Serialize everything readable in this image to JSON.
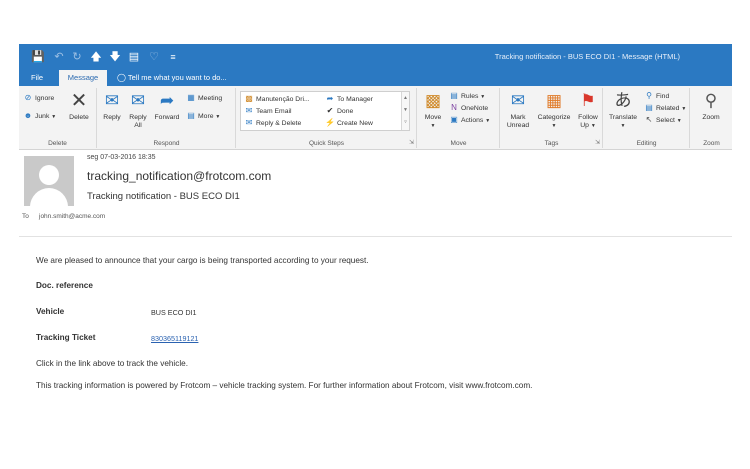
{
  "window": {
    "title": "Tracking notification - BUS ECO DI1 - Message (HTML)"
  },
  "quick_access": {
    "save_icon": "save-icon",
    "undo_icon": "undo-icon",
    "redo_icon": "redo-icon",
    "up_icon": "up-arrow-icon",
    "down_icon": "down-arrow-icon",
    "print_icon": "print-preview-icon",
    "tag_icon": "tag-icon",
    "customize_icon": "customize-icon"
  },
  "tabs": {
    "file": "File",
    "message": "Message",
    "tell_me": "Tell me what you want to do..."
  },
  "ribbon": {
    "delete_group": {
      "label": "Delete",
      "ignore": "Ignore",
      "junk": "Junk",
      "delete": "Delete"
    },
    "respond_group": {
      "label": "Respond",
      "reply": "Reply",
      "reply_all_1": "Reply",
      "reply_all_2": "All",
      "forward": "Forward",
      "meeting": "Meeting",
      "more": "More"
    },
    "quick_steps_group": {
      "label": "Quick Steps",
      "items": [
        "Manutenção Dri...",
        "Team Email",
        "Reply & Delete",
        "To Manager",
        "Done",
        "Create New"
      ]
    },
    "move_group": {
      "label": "Move",
      "move": "Move",
      "rules": "Rules",
      "onenote": "OneNote",
      "actions": "Actions"
    },
    "tags_group": {
      "label": "Tags",
      "mark_unread_1": "Mark",
      "mark_unread_2": "Unread",
      "categorize": "Categorize",
      "follow_up_1": "Follow",
      "follow_up_2": "Up"
    },
    "editing_group": {
      "label": "Editing",
      "translate": "Translate",
      "find": "Find",
      "related": "Related",
      "select": "Select"
    },
    "zoom_group": {
      "label": "Zoom",
      "zoom": "Zoom"
    }
  },
  "message": {
    "date": "seg 07-03-2016 18:35",
    "from": "tracking_notification@frotcom.com",
    "subject": "Tracking notification - BUS ECO DI1",
    "to_label": "To",
    "to": "john.smith@acme.com"
  },
  "body": {
    "intro": "We are pleased to announce that your cargo is being transported according to your request.",
    "doc_reference_label": "Doc. reference",
    "vehicle_label": "Vehicle",
    "vehicle_value": "BUS ECO DI1",
    "tracking_ticket_label": "Tracking Ticket",
    "tracking_ticket_value": "830365119121",
    "click_line": "Click in the link above to track the vehicle.",
    "powered_line": "This tracking information is powered by Frotcom – vehicle tracking system. For further information about Frotcom, visit www.frotcom.com."
  },
  "colors": {
    "accent": "#2b79c2",
    "ribbon_bg": "#f3f3f3",
    "link": "#2a62b1"
  }
}
